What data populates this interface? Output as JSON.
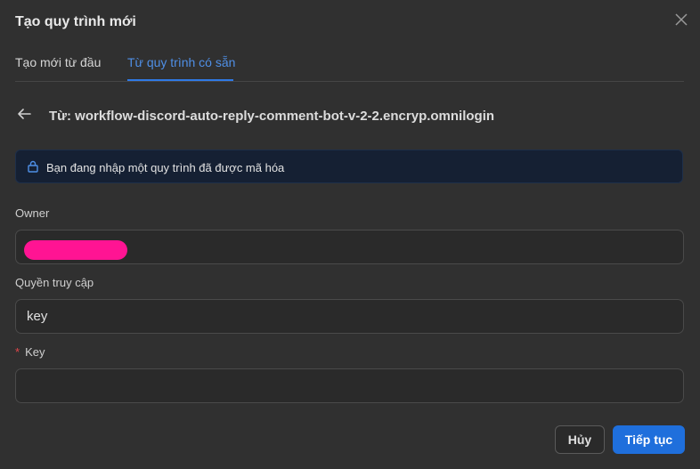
{
  "dialog": {
    "title": "Tạo quy trình mới"
  },
  "tabs": [
    {
      "label": "Tạo mới từ đầu",
      "active": false
    },
    {
      "label": "Từ quy trình có sẵn",
      "active": true
    }
  ],
  "source": {
    "text": "Từ: workflow-discord-auto-reply-comment-bot-v-2-2.encryp.omnilogin"
  },
  "notice": {
    "message": "Bạn đang nhập một quy trình đã được mã hóa",
    "icon": "lock-icon"
  },
  "form": {
    "owner": {
      "label": "Owner",
      "value": "",
      "redacted": true
    },
    "access": {
      "label": "Quyền truy cập",
      "value": "key"
    },
    "key": {
      "label": "Key",
      "required_marker": "*",
      "value": ""
    }
  },
  "buttons": {
    "cancel": "Hủy",
    "next": "Tiếp tục"
  },
  "colors": {
    "background": "#303030",
    "accent": "#1f6fdc",
    "notice_bg": "#152033",
    "redaction": "#ff1493"
  }
}
